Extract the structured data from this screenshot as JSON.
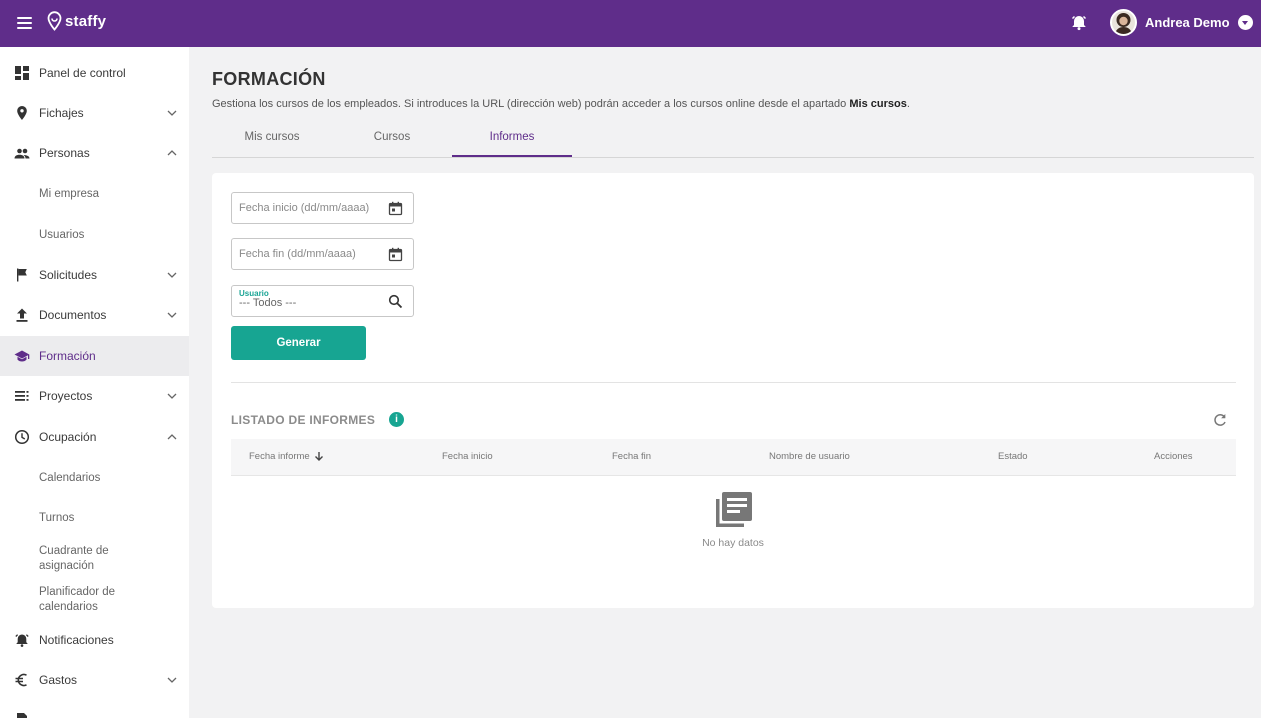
{
  "header": {
    "brand": "staffy",
    "user_name": "Andrea Demo"
  },
  "sidebar": {
    "items": [
      {
        "label": "Panel de control"
      },
      {
        "label": "Fichajes"
      },
      {
        "label": "Personas"
      },
      {
        "label": "Solicitudes"
      },
      {
        "label": "Documentos"
      },
      {
        "label": "Formación"
      },
      {
        "label": "Proyectos"
      },
      {
        "label": "Ocupación"
      },
      {
        "label": "Notificaciones"
      },
      {
        "label": "Gastos"
      }
    ],
    "personas_sub": [
      "Mi empresa",
      "Usuarios"
    ],
    "ocupacion_sub": [
      "Calendarios",
      "Turnos",
      "Cuadrante de asignación",
      "Planificador de calendarios"
    ]
  },
  "main": {
    "title": "FORMACIÓN",
    "description": "Gestiona los cursos de los empleados. Si introduces la URL (dirección web) podrán acceder a los cursos online desde el apartado",
    "description_bold": "Mis cursos",
    "description_end": ".",
    "tabs": [
      {
        "label": "Mis cursos"
      },
      {
        "label": "Cursos"
      },
      {
        "label": "Informes"
      }
    ],
    "active_tab": "Informes"
  },
  "form": {
    "fecha_inicio_placeholder": "Fecha inicio (dd/mm/aaaa)",
    "fecha_fin_placeholder": "Fecha fin (dd/mm/aaaa)",
    "usuario_label": "Usuario",
    "usuario_value": "--- Todos ---",
    "generate_label": "Generar"
  },
  "reports": {
    "title": "LISTADO DE INFORMES",
    "columns": [
      "Fecha informe",
      "Fecha inicio",
      "Fecha fin",
      "Nombre de usuario",
      "Estado",
      "Acciones"
    ],
    "empty_text": "No hay datos"
  },
  "colors": {
    "brand": "#5f2d8a",
    "accent": "#17a592"
  }
}
